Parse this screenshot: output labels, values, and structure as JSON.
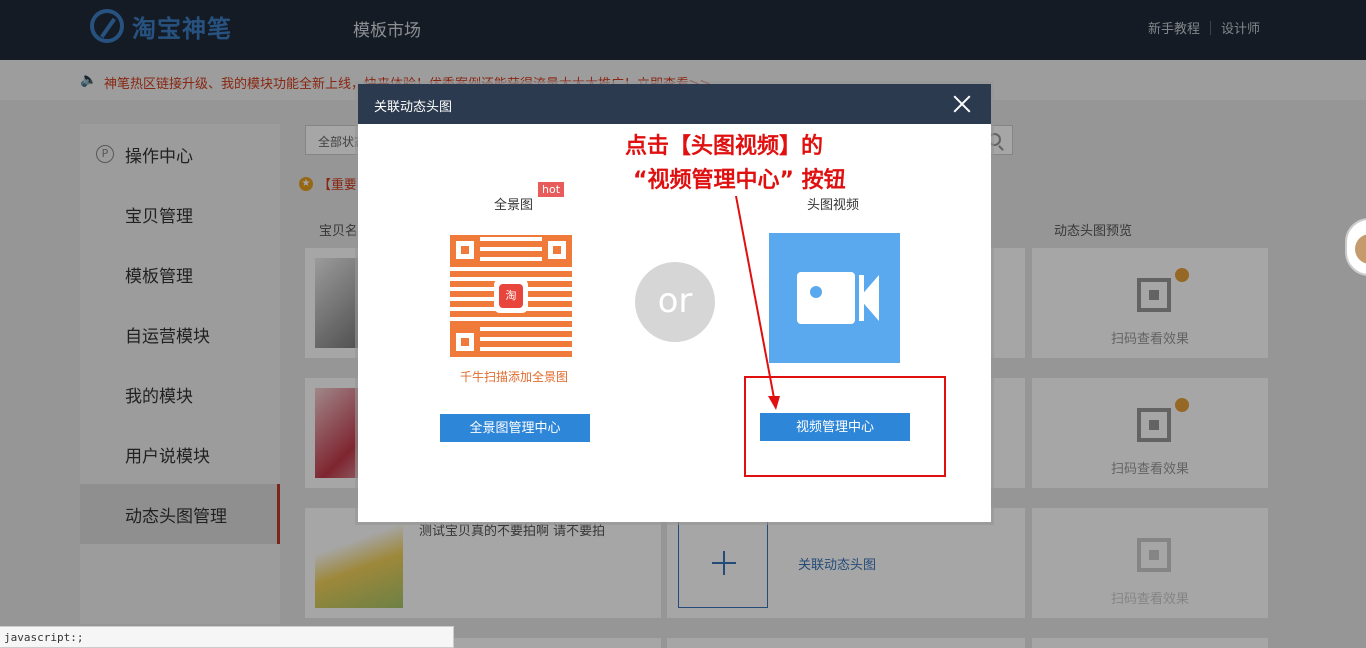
{
  "header": {
    "logo_text": "淘宝神笔",
    "nav_market": "模板市场",
    "nav_tutorial": "新手教程",
    "nav_designer": "设计师"
  },
  "notice": {
    "icon": "speaker-icon",
    "text": "神笔热区链接升级、我的模块功能全新上线，快来体验！优秀案例还能获得流量大大大推广！立即查看>>"
  },
  "sidebar": {
    "items": [
      {
        "label": "操作中心"
      },
      {
        "label": "宝贝管理"
      },
      {
        "label": "模板管理"
      },
      {
        "label": "自运营模块"
      },
      {
        "label": "我的模块"
      },
      {
        "label": "用户说模块"
      },
      {
        "label": "动态头图管理"
      }
    ]
  },
  "main": {
    "filter_value": "全部状态",
    "important_text": "【重要】",
    "columns": {
      "item_name": "宝贝名称",
      "preview": "动态头图预览"
    },
    "rows": [
      {
        "title": "",
        "scan_label": "扫码查看效果"
      },
      {
        "title": "",
        "scan_label": "扫码查看效果"
      },
      {
        "title": "测试宝贝真的不要拍啊 请不要拍",
        "link": "关联动态头图",
        "scan_label": "扫码查看效果"
      }
    ]
  },
  "modal": {
    "title": "关联动态头图",
    "annotation_line1": "点击【头图视频】的",
    "annotation_line2": "“视频管理中心” 按钮",
    "panorama_label": "全景图",
    "hot_badge": "hot",
    "qr_center": "淘",
    "qr_caption": "千牛扫描添加全景图",
    "panorama_button": "全景图管理中心",
    "or_text": "or",
    "video_label": "头图视频",
    "video_button": "视频管理中心",
    "colors": {
      "annotation": "#e01010",
      "button": "#2e86d8",
      "video_tile": "#5aa8ee",
      "qr": "#f07a3a"
    }
  },
  "status_bar": {
    "text": "javascript:;"
  }
}
